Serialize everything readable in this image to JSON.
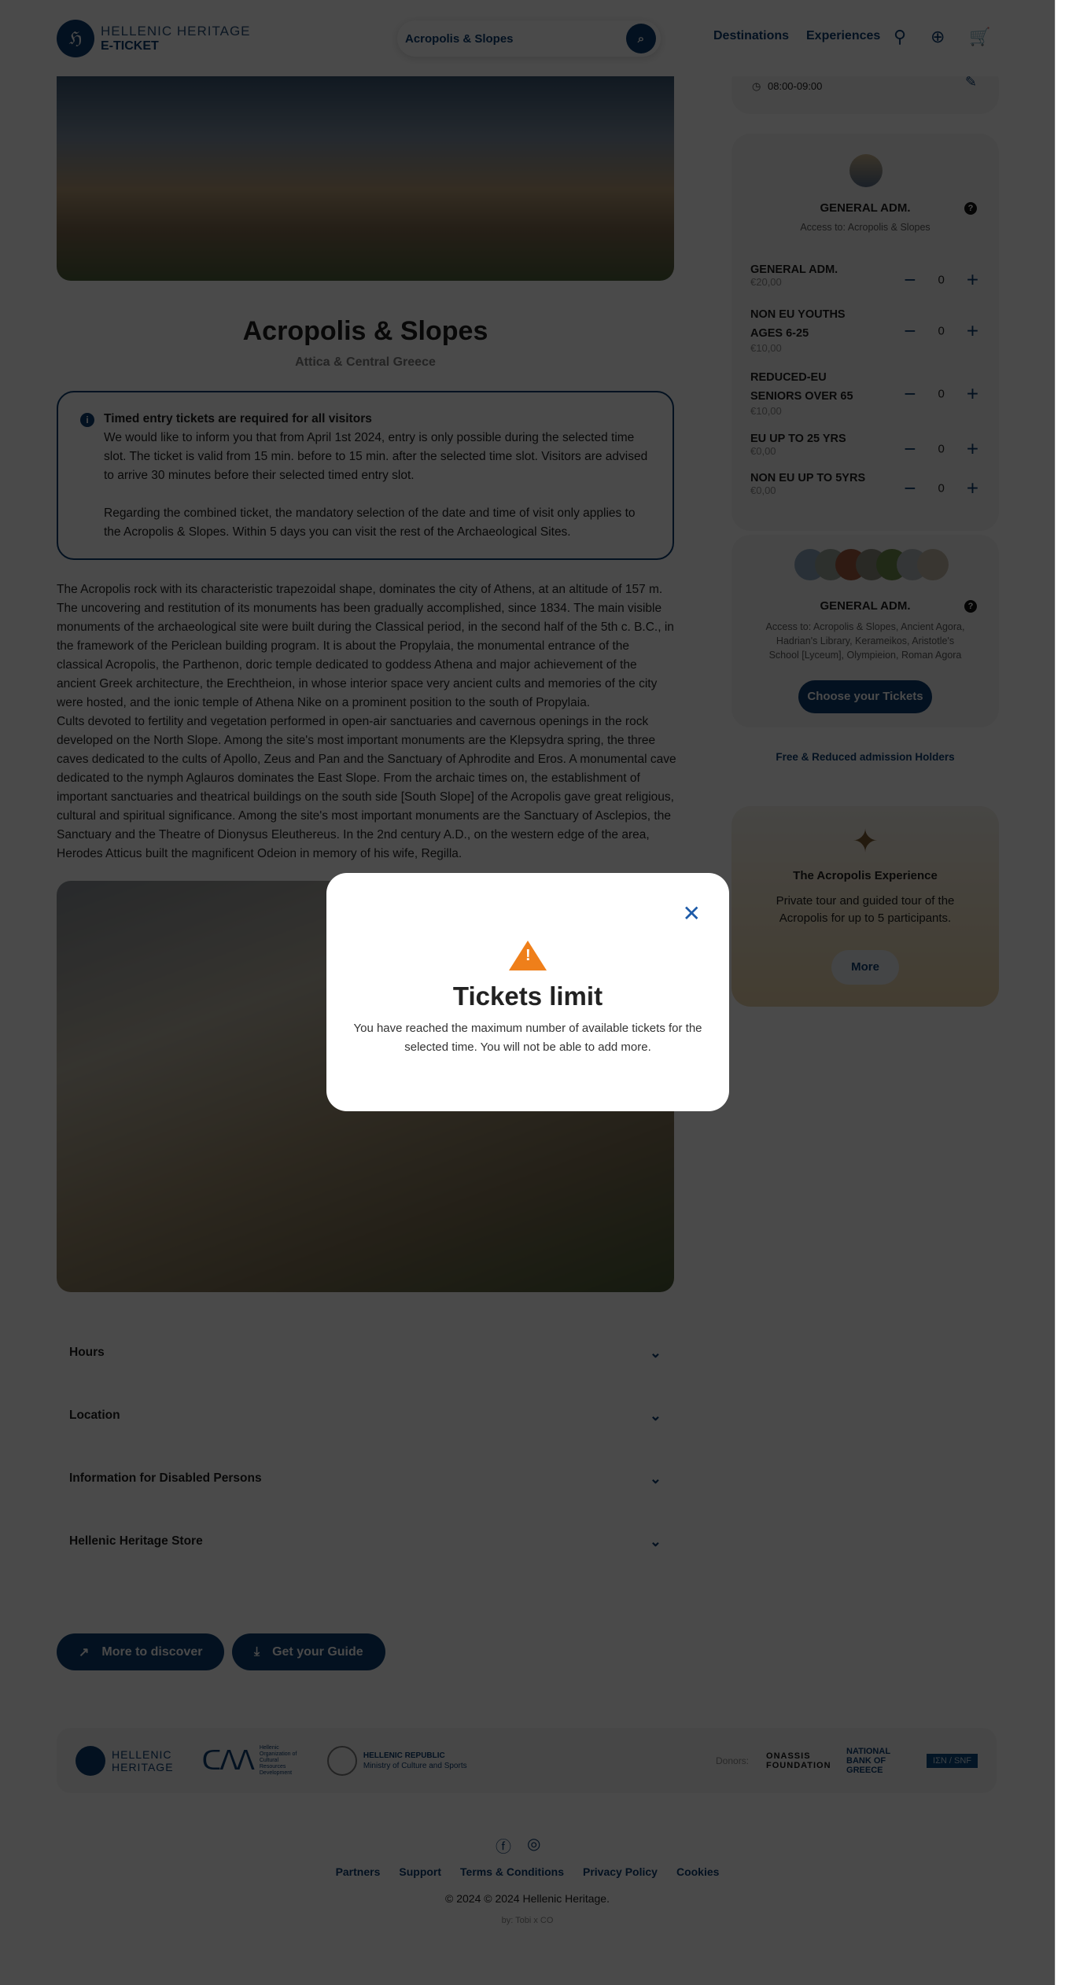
{
  "header": {
    "logo_line1": "HELLENIC HERITAGE",
    "logo_line2": "E-TICKET",
    "search_value": "Acropolis & Slopes",
    "nav": [
      "Destinations",
      "Experiences"
    ]
  },
  "site": {
    "title": "Acropolis & Slopes",
    "region": "Attica & Central Greece"
  },
  "info": {
    "heading": "Timed entry tickets are required for all visitors",
    "p1": "We would like to inform you that from April 1st 2024, entry is only possible during the selected time slot. The ticket is valid from 15 min. before to 15 min. after the selected time slot. Visitors are advised to arrive 30 minutes before their selected timed entry slot.",
    "p2": "Regarding the combined ticket, the mandatory selection of the date and time of visit only applies to the Acropolis & Slopes. Within 5 days you can visit the rest of the Archaeological Sites."
  },
  "description": {
    "p1": "The Acropolis rock with its characteristic trapezoidal shape, dominates the city of Athens, at an altitude of 157 m. The uncovering and restitution of its monuments has been gradually accomplished, since 1834. The main visible monuments of the archaeological site were built during the Classical period, in the second half of the 5th c. B.C., in the framework of the Periclean building program. It is about the Propylaia, the monumental entrance of the classical Acropolis, the Parthenon, doric temple dedicated to goddess Athena and major achievement of the ancient Greek architecture, the Erechtheion, in whose interior space very ancient cults and memories of the city were hosted, and the ionic temple of Athena Nike on a prominent position to the south of Propylaia.",
    "p2": "Cults devoted to fertility and vegetation performed in open-air sanctuaries and cavernous openings in the rock developed on the North Slope. Among the site's most important monuments are the Klepsydra spring, the three caves dedicated to the cults of Apollo, Zeus and Pan and the Sanctuary of Aphrodite and Eros. A monumental cave dedicated to the nymph Aglauros dominates the East Slope. From the archaic times on, the establishment of important sanctuaries and theatrical buildings on the south side [South Slope] of the Acropolis gave great religious, cultural and spiritual significance. Among the site's most important monuments are the Sanctuary of Asclepios, the Sanctuary and the Theatre of Dionysus Eleuthereus. In the 2nd century A.D., on the western edge of the area, Herodes Atticus built the magnificent Odeion in memory of his wife, Regilla."
  },
  "accordion": [
    "Hours",
    "Location",
    "Information for Disabled Persons",
    "Hellenic Heritage Store"
  ],
  "buttons": {
    "discover": "More to discover",
    "guide": "Get your Guide"
  },
  "sidebar": {
    "time_slot": "08:00-09:00",
    "ticket_card": {
      "title": "GENERAL ADM.",
      "access": "Access to: Acropolis & Slopes",
      "rows": [
        {
          "name": "GENERAL ADM.",
          "price": "€20,00",
          "qty": "0"
        },
        {
          "name": "NON EU YOUTHS AGES 6-25",
          "price": "€10,00",
          "qty": "0"
        },
        {
          "name": "REDUCED-EU SENIORS OVER 65",
          "price": "€10,00",
          "qty": "0"
        },
        {
          "name": "EU UP TO 25 YRS",
          "price": "€0,00",
          "qty": "0"
        },
        {
          "name": "NON EU UP TO 5YRS",
          "price": "€0,00",
          "qty": "0"
        }
      ]
    },
    "combined_card": {
      "title": "GENERAL ADM.",
      "access": "Access to: Acropolis & Slopes, Ancient Agora, Hadrian's Library, Kerameikos, Aristotle's School [Lyceum], Olympieion, Roman Agora",
      "button": "Choose your Tickets"
    },
    "free_link": "Free & Reduced admission Holders",
    "experience": {
      "title": "The Acropolis Experience",
      "text": "Private tour and guided tour of the Acropolis for up to 5 participants.",
      "button": "More"
    }
  },
  "partners": {
    "hh1": "HELLENIC",
    "hh2": "HERITAGE",
    "odap": "Hellenic Organization of Cultural Resources Development",
    "rep1": "HELLENIC REPUBLIC",
    "rep2": "Ministry of Culture and Sports",
    "donors_label": "Donors:",
    "donors": [
      "ONASSIS FOUNDATION",
      "NATIONAL BANK OF GREECE",
      "ΙΣΝ / SNF"
    ]
  },
  "footer": {
    "links": [
      "Partners",
      "Support",
      "Terms & Conditions",
      "Privacy Policy",
      "Cookies"
    ],
    "copyright": "© 2024 © 2024 Hellenic Heritage.",
    "credit": "by: Tobi x CO"
  },
  "modal": {
    "title": "Tickets limit",
    "text": "You have reached the maximum number of available tickets for the selected time. You will not be able to add more."
  },
  "colors": {
    "brand": "#0b3a6e",
    "warning": "#ef7f1a"
  }
}
